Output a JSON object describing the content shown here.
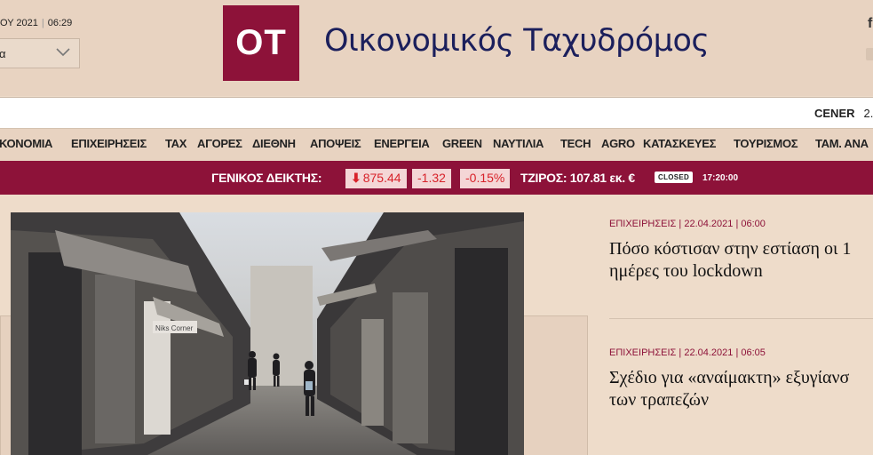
{
  "header": {
    "date_partial": "ΟΥ 2021",
    "time": "06:29",
    "lang_value": "α",
    "logo_text": "ΟΤ",
    "brand_name": "Οικονομικός Ταχυδρόμος",
    "social_icon": "f"
  },
  "ticker": {
    "stock_name": "CENER",
    "stock_value": "2."
  },
  "nav": {
    "items": [
      "ΚΟΝΟΜΙΑ",
      "ΕΠΙΧΕΙΡΗΣΕΙΣ",
      "TAX",
      "ΑΓΟΡΕΣ",
      "ΔΙΕΘΝΗ",
      "ΑΠΟΨΕΙΣ",
      "ΕΝΕΡΓΕΙΑ",
      "GREEN",
      "ΝΑΥΤΙΛΙΑ",
      "TECH",
      "AGRO",
      "ΚΑΤΑΣΚΕΥΕΣ",
      "ΤΟΥΡΙΣΜΟΣ",
      "ΤΑΜ. ΑΝΑ"
    ]
  },
  "market": {
    "index_label": "ΓΕΝΙΚΟΣ ΔΕΙΚΤΗΣ:",
    "index_value": "875.44",
    "change": "-1.32",
    "change_pct": "-0.15%",
    "turnover": "ΤΖΙΡΟΣ: 107.81 εκ. €",
    "status": "CLOSED",
    "time": "17:20:00",
    "colors": {
      "bar": "#8d1239",
      "chip_bg": "#f4d6d6",
      "negative": "#d8222a"
    }
  },
  "articles": [
    {
      "category": "ΕΠΙΧΕΙΡΗΣΕΙΣ",
      "date": "22.04.2021 | 06:00",
      "title_line1": "Πόσο κόστισαν στην εστίαση οι 1",
      "title_line2": "ημέρες του lockdown"
    },
    {
      "category": "ΕΠΙΧΕΙΡΗΣΕΙΣ",
      "date": "22.04.2021 | 06:05",
      "title_line1": "Σχέδιο για «αναίμακτη» εξυγίανσ",
      "title_line2": "των τραπεζών"
    }
  ],
  "photo": {
    "shop_sign": "Niks Corner"
  }
}
